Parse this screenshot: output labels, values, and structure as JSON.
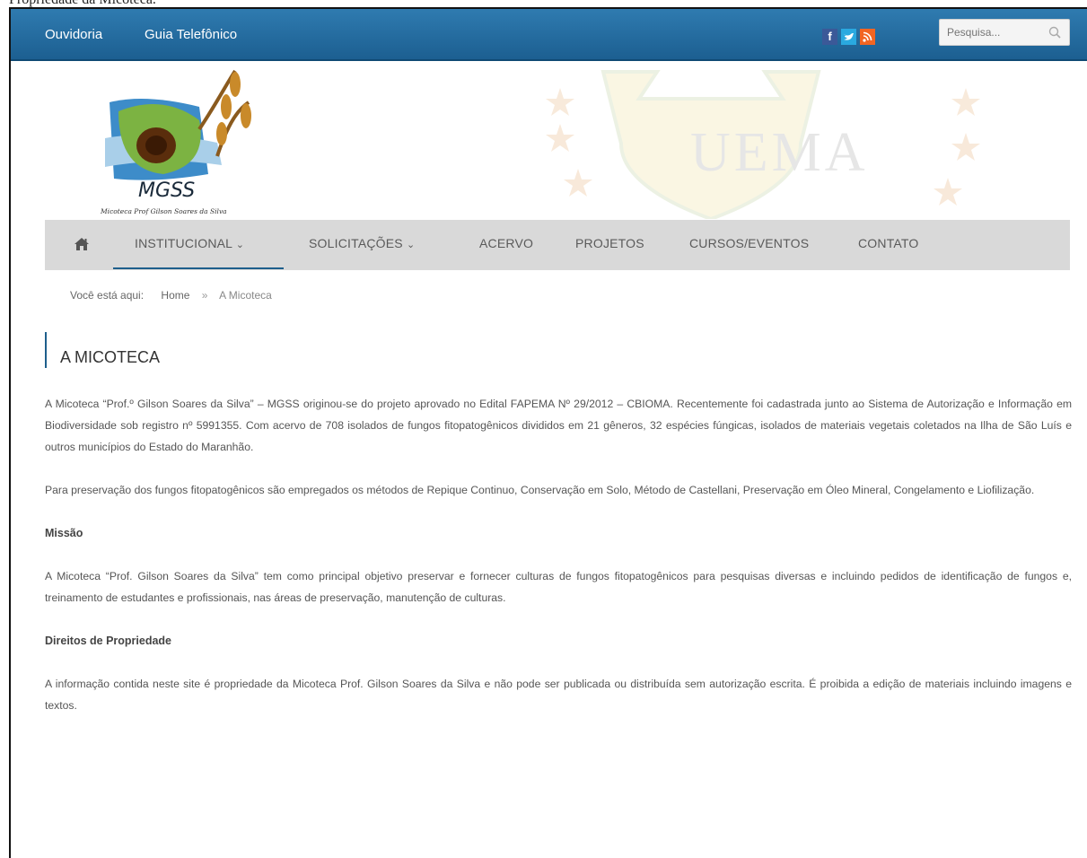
{
  "caption": "Propriedade da Micoteca.",
  "topbar": {
    "links": [
      "Ouvidoria",
      "Guia Telefônico"
    ],
    "social": [
      {
        "icon": "facebook-icon",
        "glyph": "f",
        "color": "#3b5998"
      },
      {
        "icon": "twitter-icon",
        "glyph": "t",
        "color": "#2aa9e0"
      },
      {
        "icon": "rss-icon",
        "glyph": "◢",
        "color": "#f26522"
      }
    ],
    "search_placeholder": "Pesquisa..."
  },
  "banner": {
    "logo_title": "MGSS",
    "logo_subtitle": "Micoteca Prof Gilson Soares da Silva",
    "watermark": "UEMA"
  },
  "nav": {
    "home_icon": "home-icon",
    "items": [
      "INSTITUCIONAL",
      "SOLICITAÇÕES",
      "ACERVO",
      "PROJETOS",
      "CURSOS/EVENTOS",
      "CONTATO"
    ]
  },
  "breadcrumb": {
    "prefix": "Você está aqui:",
    "home": "Home",
    "separator": "»",
    "current": "A Micoteca"
  },
  "page": {
    "title": "A MICOTECA",
    "p1": "A Micoteca “Prof.º Gilson Soares da Silva” – MGSS originou-se do projeto aprovado no Edital FAPEMA Nº 29/2012 – CBIOMA. Recentemente foi cadastrada junto ao Sistema de Autorização e Informação em Biodiversidade sob registro nº 5991355. Com acervo de 708 isolados de fungos fitopatogênicos divididos em 21 gêneros, 32 espécies fúngicas, isolados de materiais vegetais coletados na Ilha de São Luís e outros municípios do Estado do Maranhão.",
    "p2": "Para preservação dos fungos fitopatogênicos são empregados os métodos de Repique Continuo, Conservação em Solo, Método de Castellani, Preservação em Óleo Mineral, Congelamento e Liofilização.",
    "h_missao": "Missão",
    "p3": "A Micoteca “Prof. Gilson Soares da Silva” tem como principal objetivo preservar e fornecer culturas de fungos fitopatogênicos para pesquisas diversas e incluindo pedidos de identificação de fungos e, treinamento de estudantes e profissionais, nas áreas de preservação, manutenção de culturas.",
    "h_direitos": "Direitos de Propriedade",
    "p4": "A informação contida neste site é propriedade da Micoteca Prof. Gilson Soares da Silva e não pode ser publicada ou distribuída sem autorização escrita. É proibida a edição de materiais incluindo imagens e textos."
  },
  "colors": {
    "topbar": "#1c5f91",
    "nav_bg": "#d9d9d9",
    "accent": "#1e5f8c"
  }
}
